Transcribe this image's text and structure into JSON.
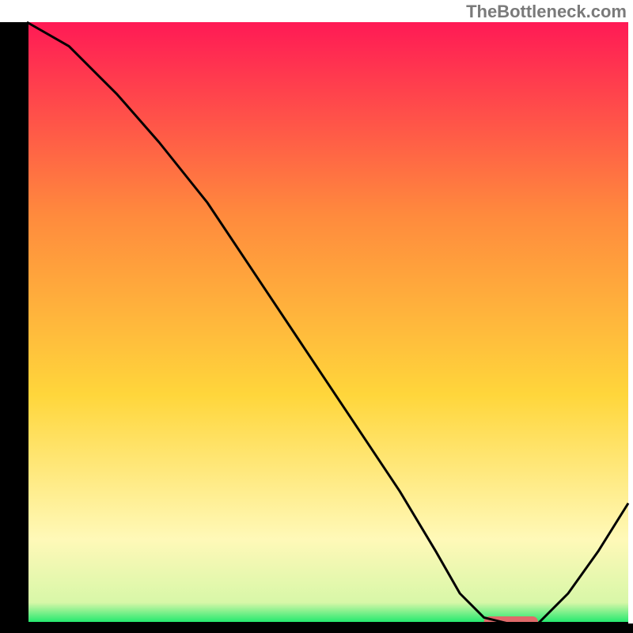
{
  "watermark": "TheBottleneck.com",
  "colors": {
    "gradient_top": "#ff1a55",
    "gradient_mid1": "#ff8a3d",
    "gradient_mid2": "#ffd63b",
    "gradient_low": "#fff9b8",
    "gradient_bottom": "#17e86a",
    "curve": "#000000",
    "marker": "#e06a6a",
    "border": "#000000"
  },
  "chart_data": {
    "type": "line",
    "title": "",
    "xlabel": "",
    "ylabel": "",
    "xlim": [
      0,
      100
    ],
    "ylim": [
      0,
      100
    ],
    "series": [
      {
        "name": "bottleneck-curve",
        "x": [
          0,
          7,
          15,
          22,
          30,
          38,
          46,
          54,
          62,
          68,
          72,
          76,
          80,
          85,
          90,
          95,
          100
        ],
        "values": [
          103,
          96,
          88,
          80,
          70,
          58,
          46,
          34,
          22,
          12,
          5,
          1,
          0,
          0,
          5,
          12,
          20
        ]
      }
    ],
    "marker": {
      "x_start": 76,
      "x_end": 85,
      "y": 0
    },
    "annotations": []
  }
}
